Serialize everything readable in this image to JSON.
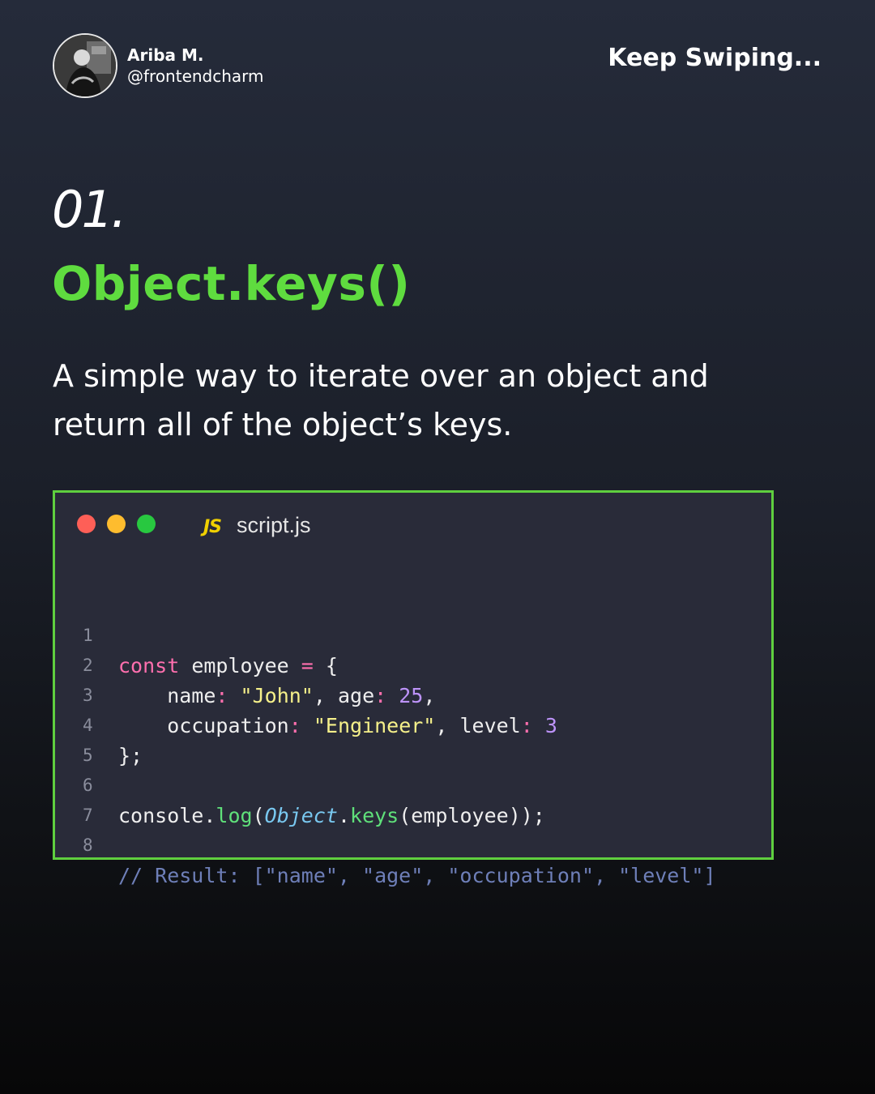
{
  "header": {
    "author_name": "Ariba M.",
    "author_handle": "@frontendcharm",
    "keep_swiping": "Keep Swiping..."
  },
  "slide": {
    "number": "01.",
    "title": "Object.keys()",
    "description": "A simple way to iterate over an object and return all of the object’s keys."
  },
  "code_window": {
    "language_badge": "JS",
    "file_name": "script.js",
    "lines": [
      {
        "number": "1",
        "tokens": [
          {
            "text": "const",
            "kind": "kw"
          },
          {
            "text": " employee ",
            "kind": "plain"
          },
          {
            "text": "=",
            "kind": "punct"
          },
          {
            "text": " {",
            "kind": "plain"
          }
        ]
      },
      {
        "number": "2",
        "tokens": [
          {
            "text": "    name",
            "kind": "plain"
          },
          {
            "text": ":",
            "kind": "punct"
          },
          {
            "text": " ",
            "kind": "plain"
          },
          {
            "text": "\"John\"",
            "kind": "str"
          },
          {
            "text": ", age",
            "kind": "plain"
          },
          {
            "text": ":",
            "kind": "punct"
          },
          {
            "text": " ",
            "kind": "plain"
          },
          {
            "text": "25",
            "kind": "num"
          },
          {
            "text": ",",
            "kind": "plain"
          }
        ]
      },
      {
        "number": "3",
        "tokens": [
          {
            "text": "    occupation",
            "kind": "plain"
          },
          {
            "text": ":",
            "kind": "punct"
          },
          {
            "text": " ",
            "kind": "plain"
          },
          {
            "text": "\"Engineer\"",
            "kind": "str"
          },
          {
            "text": ", level",
            "kind": "plain"
          },
          {
            "text": ":",
            "kind": "punct"
          },
          {
            "text": " ",
            "kind": "plain"
          },
          {
            "text": "3",
            "kind": "num"
          }
        ]
      },
      {
        "number": "4",
        "tokens": [
          {
            "text": "};",
            "kind": "plain"
          }
        ]
      },
      {
        "number": "5",
        "tokens": []
      },
      {
        "number": "6",
        "tokens": [
          {
            "text": "console.",
            "kind": "plain"
          },
          {
            "text": "log",
            "kind": "fn"
          },
          {
            "text": "(",
            "kind": "plain"
          },
          {
            "text": "Object",
            "kind": "cls"
          },
          {
            "text": ".",
            "kind": "plain"
          },
          {
            "text": "keys",
            "kind": "fn"
          },
          {
            "text": "(employee));",
            "kind": "plain"
          }
        ]
      },
      {
        "number": "7",
        "tokens": []
      },
      {
        "number": "8",
        "tokens": [
          {
            "text": "// Result: [\"name\", \"age\", \"occupation\", \"level\"]",
            "kind": "comment"
          }
        ]
      }
    ]
  },
  "colors": {
    "accent_green": "#5fdc3f",
    "window_border": "#5fcf3f",
    "window_background": "#292b39",
    "dot_red": "#fe5f57",
    "dot_yellow": "#febc2e",
    "dot_green": "#28c840"
  }
}
